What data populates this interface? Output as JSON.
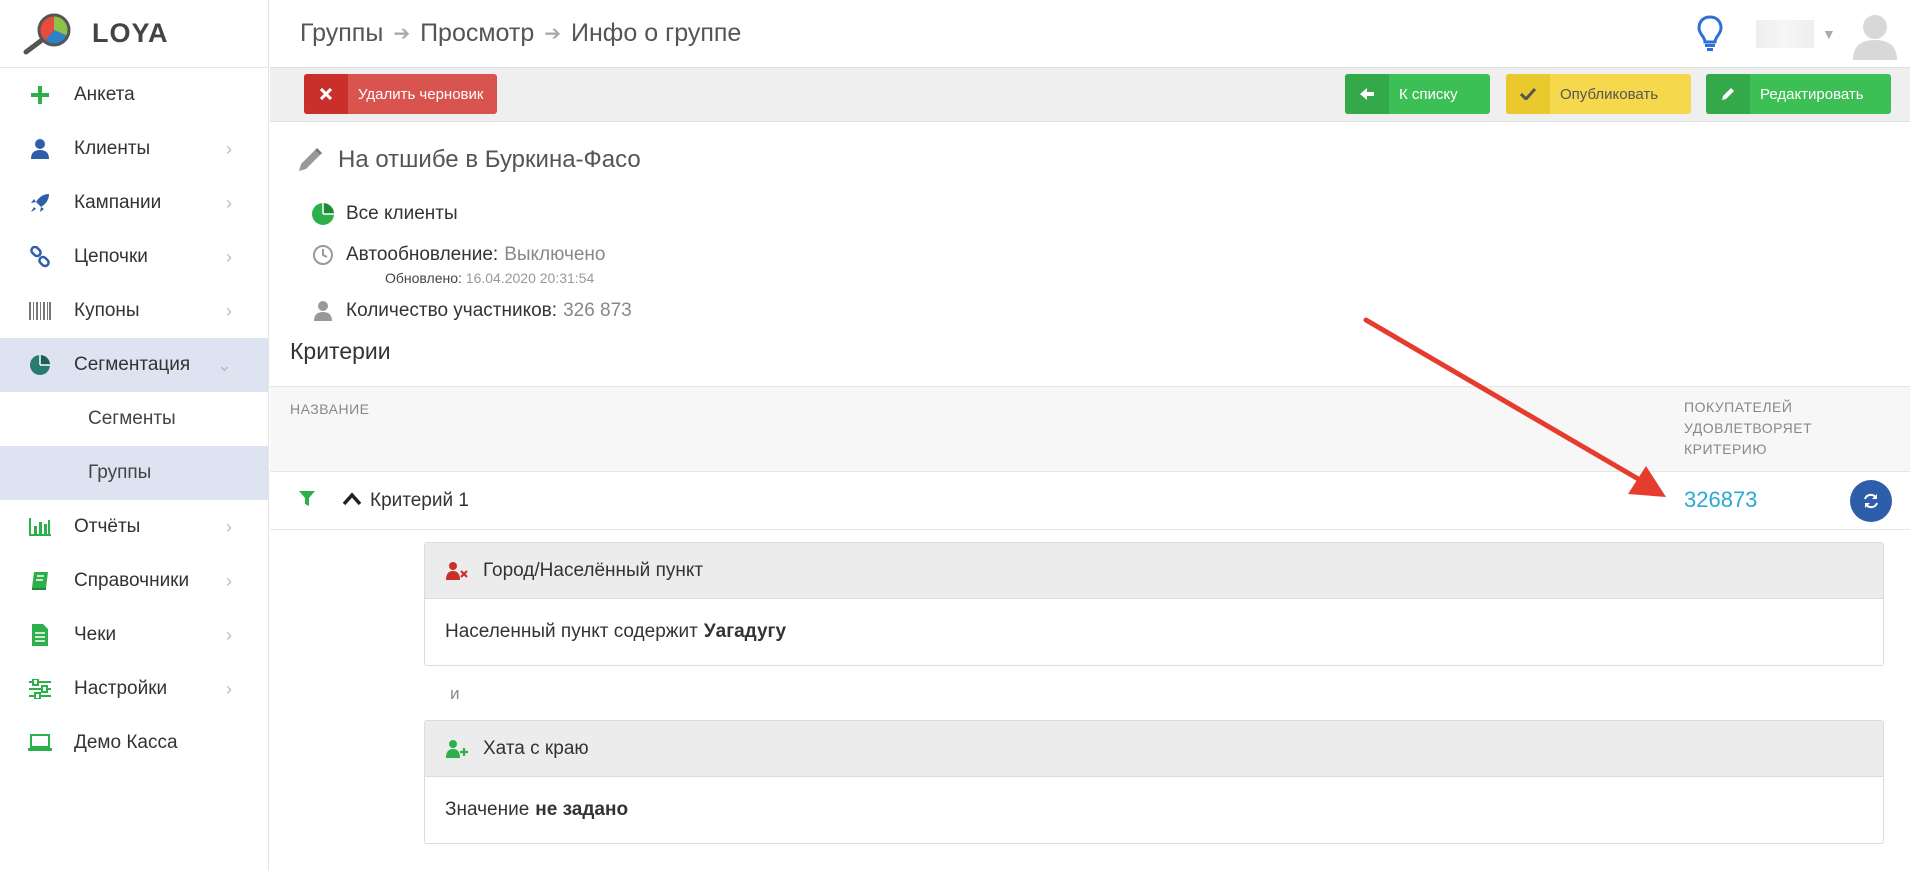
{
  "app": {
    "name": "LOYA"
  },
  "sidebar": {
    "items": [
      {
        "label": "Анкета",
        "icon": "plus-icon",
        "chevron": false
      },
      {
        "label": "Клиенты",
        "icon": "user-icon",
        "chevron": true
      },
      {
        "label": "Кампании",
        "icon": "rocket-icon",
        "chevron": true
      },
      {
        "label": "Цепочки",
        "icon": "link-icon",
        "chevron": true
      },
      {
        "label": "Купоны",
        "icon": "barcode-icon",
        "chevron": true
      },
      {
        "label": "Сегментация",
        "icon": "pie-chart-icon",
        "chevron": true,
        "active": true
      },
      {
        "label": "Отчёты",
        "icon": "bar-chart-icon",
        "chevron": true
      },
      {
        "label": "Справочники",
        "icon": "book-icon",
        "chevron": true
      },
      {
        "label": "Чеки",
        "icon": "receipt-icon",
        "chevron": true
      },
      {
        "label": "Настройки",
        "icon": "sliders-icon",
        "chevron": true
      },
      {
        "label": "Демо Касса",
        "icon": "laptop-icon",
        "chevron": false
      }
    ],
    "sub_items": [
      {
        "label": "Сегменты"
      },
      {
        "label": "Группы",
        "active": true
      }
    ]
  },
  "breadcrumb": [
    "Группы",
    "Просмотр",
    "Инфо о группе"
  ],
  "toolbar": {
    "delete_draft": "Удалить черновик",
    "to_list": "К списку",
    "publish": "Опубликовать",
    "edit": "Редактировать"
  },
  "group": {
    "title": "На отшибе в Буркина-Фасо",
    "all_clients": "Все клиенты",
    "autoupdate_label": "Автообновление:",
    "autoupdate_value": "Выключено",
    "updated_label": "Обновлено:",
    "updated_value": "16.04.2020 20:31:54",
    "members_label": "Количество участников:",
    "members_value": "326 873"
  },
  "criteria": {
    "section_title": "Критерии",
    "col_name": "НАЗВАНИЕ",
    "col_buyers_line1": "ПОКУПАТЕЛЕЙ",
    "col_buyers_line2": "УДОВЛЕТВОРЯЕТ",
    "col_buyers_line3": "КРИТЕРИЮ",
    "row_name": "Критерий 1",
    "row_count": "326873",
    "and_label": "и",
    "conditions": [
      {
        "title": "Город/Населённый пункт",
        "body_prefix": "Населенный пункт содержит",
        "body_bold": "Уагадугу",
        "icon": "user-remove-icon"
      },
      {
        "title": "Хата с краю",
        "body_prefix": "Значение",
        "body_bold": "не задано",
        "icon": "user-add-icon"
      }
    ]
  },
  "colors": {
    "accent_green": "#3cbf55",
    "danger_red": "#d9534f",
    "warning_yellow": "#f5d84b",
    "link_blue": "#2aa9d6",
    "annotation_arrow": "#e53c2e"
  }
}
